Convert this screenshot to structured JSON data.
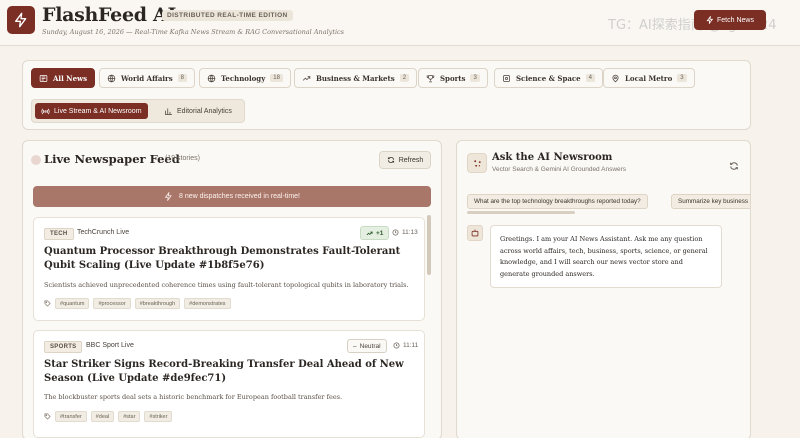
{
  "header": {
    "brand": "FlashFeed AI",
    "edition": "DISTRIBUTED REAL-TIME EDITION",
    "subline": "Sunday, August 16, 2026 — Real-Time Kafka News Stream & RAG Conversational Analytics",
    "fetch_label": "Fetch News",
    "watermark": "TG：AI探索指南 @ligc1024"
  },
  "categories": [
    {
      "label": "All News",
      "count": "",
      "icon": "newspaper-icon",
      "active": true
    },
    {
      "label": "World Affairs",
      "count": "8",
      "icon": "globe-icon"
    },
    {
      "label": "Technology",
      "count": "18",
      "icon": "globe-icon"
    },
    {
      "label": "Business & Markets",
      "count": "2",
      "icon": "trending-up-icon"
    },
    {
      "label": "Sports",
      "count": "3",
      "icon": "trophy-icon"
    },
    {
      "label": "Science & Space",
      "count": "4",
      "icon": "atom-icon"
    },
    {
      "label": "Local Metro",
      "count": "3",
      "icon": "map-pin-icon"
    }
  ],
  "modes": [
    {
      "label": "Live Stream & AI Newsroom",
      "icon": "broadcast-icon",
      "active": true
    },
    {
      "label": "Editorial Analytics",
      "icon": "bar-chart-icon"
    }
  ],
  "feed": {
    "title": "Live Newspaper Feed",
    "count_text": "(19 stories)",
    "refresh_label": "Refresh",
    "banner": "8 new dispatches received in real-time!",
    "stories": [
      {
        "tag": "TECH",
        "source": "TechCrunch Live",
        "sentiment": "+1",
        "sentiment_type": "positive",
        "time": "11:13",
        "headline": "Quantum Processor Breakthrough Demonstrates Fault-Tolerant Qubit Scaling (Live Update #1b8f5e76)",
        "summary": "Scientists achieved unprecedented coherence times using fault-tolerant topological qubits in laboratory trials.",
        "hashtags": [
          "#quantum",
          "#processor",
          "#breakthrough",
          "#demonstrates"
        ]
      },
      {
        "tag": "SPORTS",
        "source": "BBC Sport Live",
        "sentiment": "Neutral",
        "sentiment_type": "neutral",
        "time": "11:11",
        "headline": "Star Striker Signs Record-Breaking Transfer Deal Ahead of New Season (Live Update #de9fec71)",
        "summary": "The blockbuster sports deal sets a historic benchmark for European football transfer fees.",
        "hashtags": [
          "#transfer",
          "#deal",
          "#star",
          "#striker"
        ]
      }
    ]
  },
  "ai": {
    "title": "Ask the AI Newsroom",
    "subtitle": "Vector Search & Gemini AI Grounded Answers",
    "suggestions": [
      "What are the top technology breakthroughs reported today?",
      "Summarize key business"
    ],
    "greeting": "Greetings. I am your AI News Assistant. Ask me any question across world affairs, tech, business, sports, science, or general knowledge, and I will search our news vector store and generate grounded answers."
  },
  "colors": {
    "accent": "#7a2e24",
    "banner": "#a9776a",
    "background": "#f7f3ec"
  }
}
